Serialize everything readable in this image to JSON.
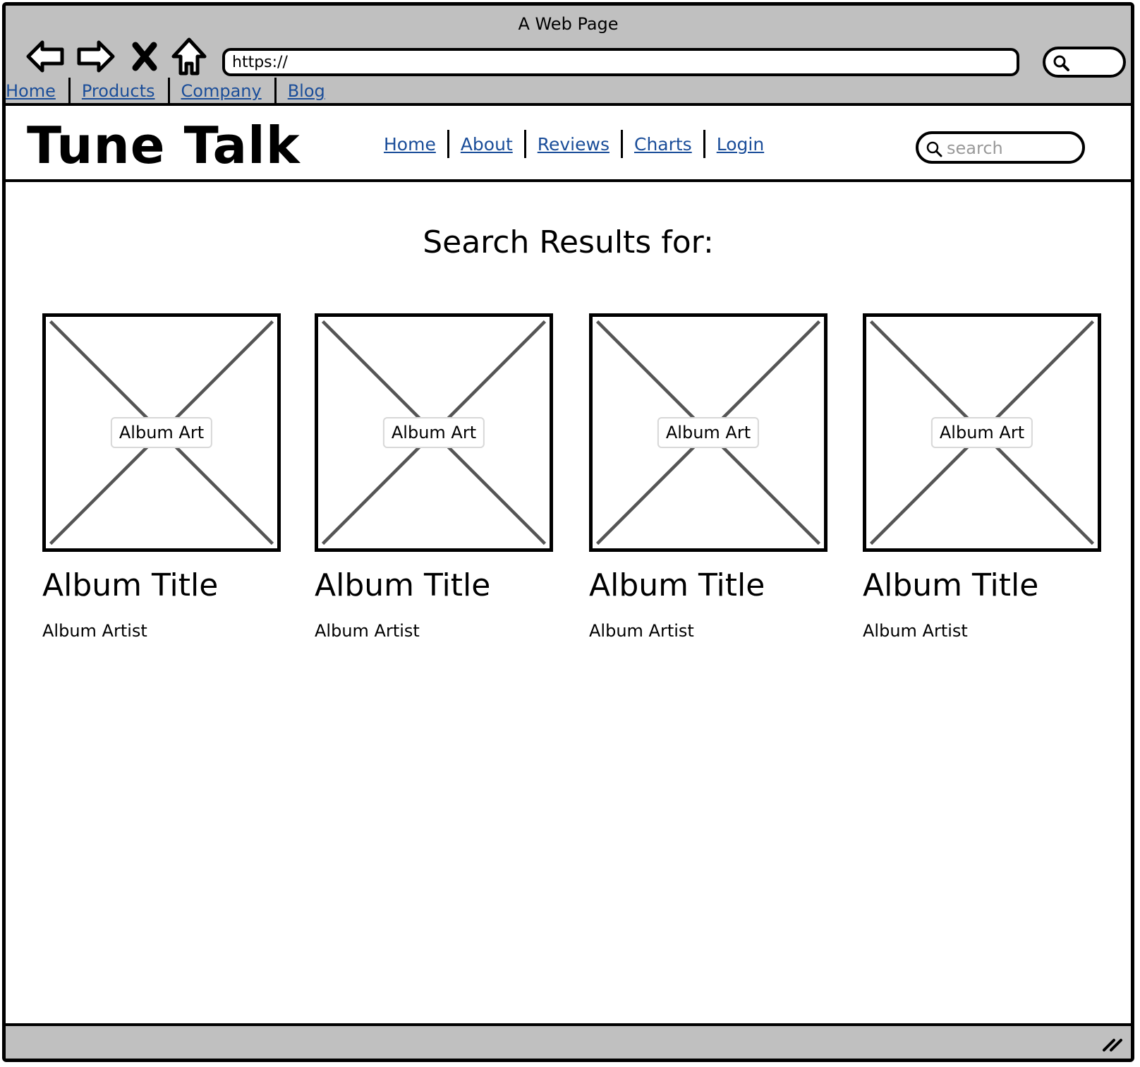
{
  "window": {
    "title": "A Web Page"
  },
  "browser": {
    "url": "https://",
    "links": [
      "Home",
      "Products",
      "Company",
      "Blog"
    ]
  },
  "site": {
    "logo": "Tune Talk",
    "nav": [
      "Home",
      "About",
      "Reviews",
      "Charts",
      "Login"
    ],
    "search_placeholder": "search"
  },
  "results": {
    "heading": "Search Results for:",
    "albums": [
      {
        "art_label": "Album Art",
        "title": "Album Title",
        "artist": "Album Artist"
      },
      {
        "art_label": "Album Art",
        "title": "Album Title",
        "artist": "Album Artist"
      },
      {
        "art_label": "Album Art",
        "title": "Album Title",
        "artist": "Album Artist"
      },
      {
        "art_label": "Album Art",
        "title": "Album Title",
        "artist": "Album Artist"
      }
    ]
  },
  "icons": {
    "back": "back-arrow-icon",
    "forward": "forward-arrow-icon",
    "stop": "close-icon",
    "home": "home-icon",
    "search": "search-icon",
    "resize": "resize-grip-icon"
  },
  "colors": {
    "chrome": "#c0c0c0",
    "link": "#1a4d99",
    "placeholder_cross": "#555555"
  }
}
